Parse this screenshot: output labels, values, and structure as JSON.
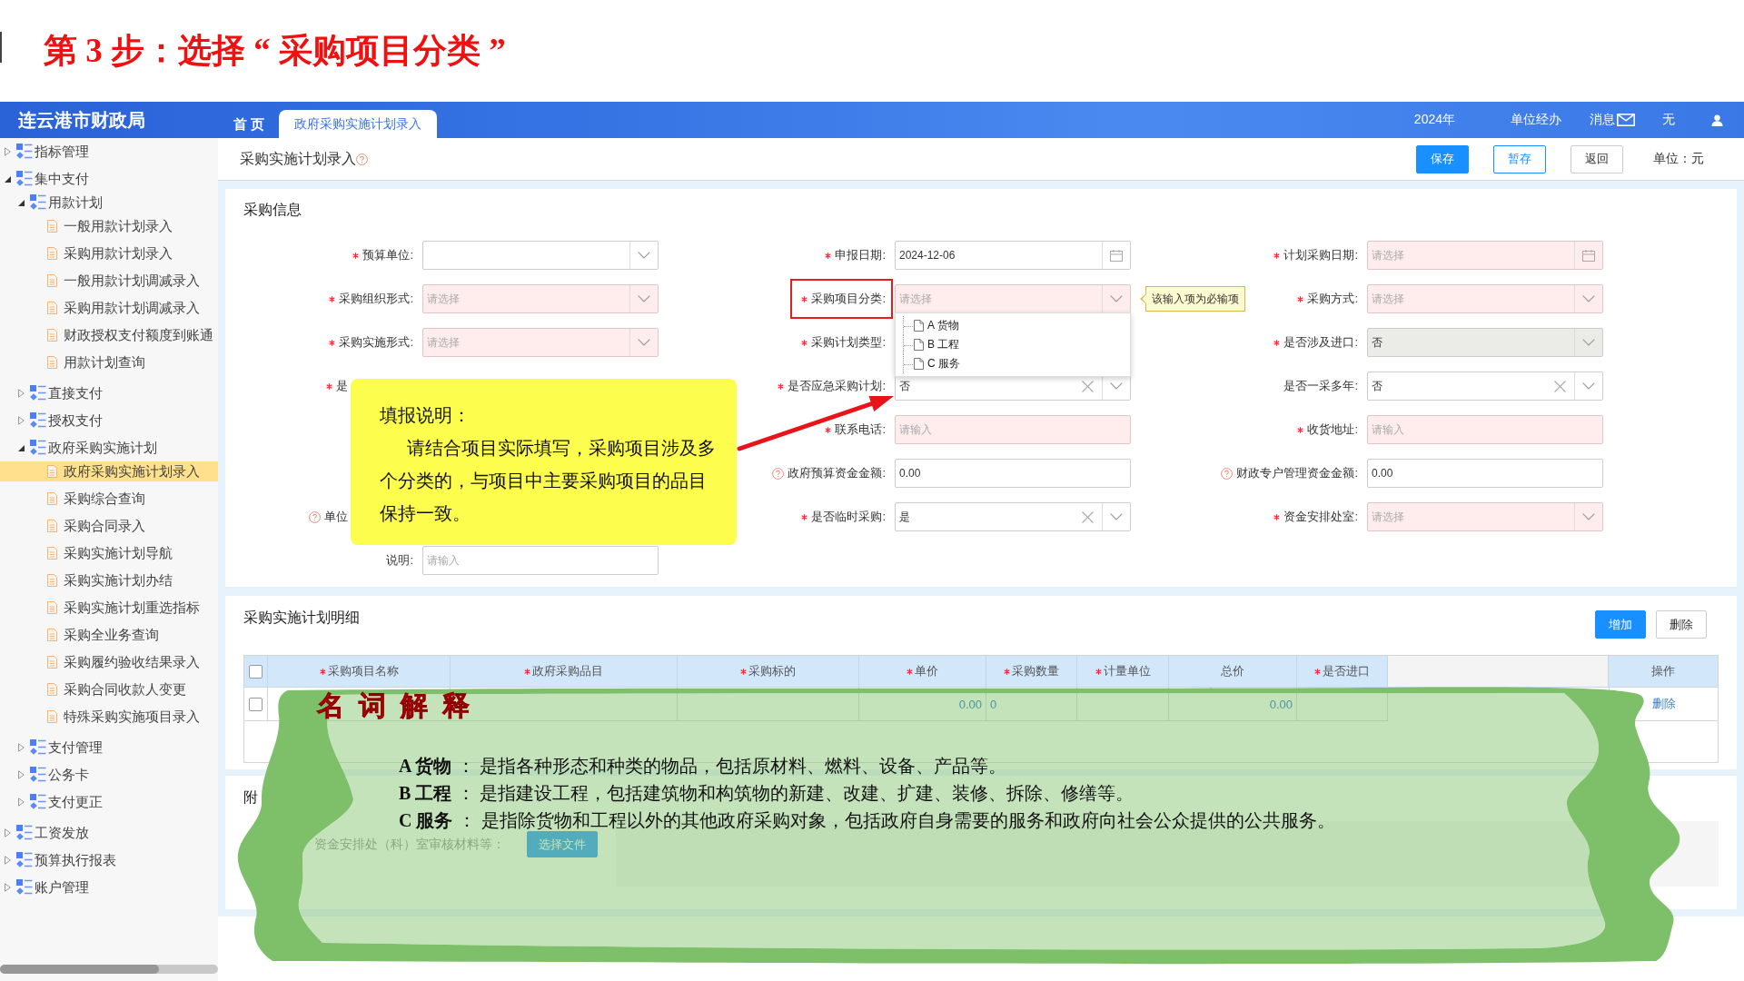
{
  "slide_title": "第 3 步：选择 “ 采购项目分类 ”",
  "header": {
    "logo": "连云港市财政局",
    "tabs": [
      {
        "label": "首 页",
        "selected": false
      },
      {
        "label": "政府采购实施计划录入",
        "selected": true
      }
    ],
    "year": "2024年",
    "role": "单位经办",
    "messages": "消息",
    "user": "无"
  },
  "sidebar": {
    "items": [
      {
        "label": "指标管理",
        "kind": "group",
        "expanded": false,
        "selected": false
      },
      {
        "label": "集中支付",
        "kind": "group",
        "expanded": true,
        "selected": false,
        "children": [
          {
            "label": "用款计划",
            "kind": "group",
            "expanded": true,
            "selected": false,
            "children": [
              {
                "label": "一般用款计划录入",
                "kind": "leaf",
                "selected": false
              },
              {
                "label": "采购用款计划录入",
                "kind": "leaf",
                "selected": false
              },
              {
                "label": "一般用款计划调减录入",
                "kind": "leaf",
                "selected": false
              },
              {
                "label": "采购用款计划调减录入",
                "kind": "leaf",
                "selected": false
              },
              {
                "label": "财政授权支付额度到账通",
                "kind": "leaf",
                "selected": false
              },
              {
                "label": "用款计划查询",
                "kind": "leaf",
                "selected": false
              }
            ]
          },
          {
            "label": "直接支付",
            "kind": "group",
            "expanded": false,
            "selected": false
          },
          {
            "label": "授权支付",
            "kind": "group",
            "expanded": false,
            "selected": false
          },
          {
            "label": "政府采购实施计划",
            "kind": "group",
            "expanded": true,
            "selected": false,
            "children": [
              {
                "label": "政府采购实施计划录入",
                "kind": "leaf",
                "selected": true
              },
              {
                "label": "采购综合查询",
                "kind": "leaf",
                "selected": false
              },
              {
                "label": "采购合同录入",
                "kind": "leaf",
                "selected": false
              },
              {
                "label": "采购实施计划导航",
                "kind": "leaf",
                "selected": false
              },
              {
                "label": "采购实施计划办结",
                "kind": "leaf",
                "selected": false
              },
              {
                "label": "采购实施计划重选指标",
                "kind": "leaf",
                "selected": false
              },
              {
                "label": "采购全业务查询",
                "kind": "leaf",
                "selected": false
              },
              {
                "label": "采购履约验收结果录入",
                "kind": "leaf",
                "selected": false
              },
              {
                "label": "采购合同收款人变更",
                "kind": "leaf",
                "selected": false
              },
              {
                "label": "特殊采购实施项目录入",
                "kind": "leaf",
                "selected": false
              }
            ]
          },
          {
            "label": "支付管理",
            "kind": "group",
            "expanded": false,
            "selected": false
          },
          {
            "label": "公务卡",
            "kind": "group",
            "expanded": false,
            "selected": false
          },
          {
            "label": "支付更正",
            "kind": "group",
            "expanded": false,
            "selected": false
          }
        ]
      },
      {
        "label": "工资发放",
        "kind": "group",
        "expanded": false,
        "selected": false
      },
      {
        "label": "预算执行报表",
        "kind": "group",
        "expanded": false,
        "selected": false
      },
      {
        "label": "账户管理",
        "kind": "group",
        "expanded": false,
        "selected": false
      }
    ]
  },
  "page": {
    "title": "采购实施计划录入",
    "help": true,
    "buttons": [
      {
        "label": "保存",
        "kind": "primary"
      },
      {
        "label": "暂存",
        "kind": "secondary"
      },
      {
        "label": "返回",
        "kind": "default"
      }
    ],
    "unit": "单位：元"
  },
  "form": {
    "title": "采购信息",
    "rows": [
      [
        {
          "kind": "field",
          "label": "预算单位:",
          "required": true,
          "help": false,
          "highlighted": false,
          "field": {
            "kind": "select",
            "invalid": false,
            "disabled": false
          }
        },
        {
          "kind": "field",
          "label": "申报日期:",
          "required": true,
          "help": false,
          "highlighted": false,
          "field": {
            "kind": "date",
            "value": "2024-12-06",
            "invalid": false,
            "disabled": false
          }
        },
        {
          "kind": "field",
          "label": "计划采购日期:",
          "required": true,
          "help": false,
          "highlighted": false,
          "field": {
            "kind": "date",
            "placeholder": "请选择",
            "invalid": true,
            "disabled": false
          }
        }
      ],
      [
        {
          "kind": "field",
          "label": "采购组织形式:",
          "required": true,
          "help": false,
          "highlighted": false,
          "field": {
            "kind": "select",
            "placeholder": "请选择",
            "invalid": true,
            "disabled": false
          }
        },
        {
          "kind": "field",
          "label": "采购项目分类:",
          "required": true,
          "help": false,
          "highlighted": true,
          "field": {
            "kind": "select",
            "placeholder": "请选择",
            "invalid": true,
            "disabled": false,
            "tip": "该输入项为必输项",
            "options": [
              {
                "label": "A 货物",
                "selected": false
              },
              {
                "label": "B 工程",
                "selected": false
              },
              {
                "label": "C 服务",
                "selected": false
              }
            ]
          }
        },
        {
          "kind": "field",
          "label": "采购方式:",
          "required": true,
          "help": false,
          "highlighted": false,
          "field": {
            "kind": "select",
            "placeholder": "请选择",
            "invalid": true,
            "disabled": false
          }
        }
      ],
      [
        {
          "kind": "field",
          "label": "采购实施形式:",
          "required": true,
          "help": false,
          "highlighted": false,
          "field": {
            "kind": "select",
            "placeholder": "请选择",
            "invalid": true,
            "disabled": false
          }
        },
        {
          "kind": "field",
          "label": "采购计划类型:",
          "required": true,
          "help": false,
          "highlighted": false
        },
        {
          "kind": "field",
          "label": "是否涉及进口:",
          "required": true,
          "help": false,
          "highlighted": false,
          "field": {
            "kind": "select",
            "value": "否",
            "invalid": false,
            "disabled": true
          }
        }
      ],
      [
        {
          "kind": "clipped",
          "label": "是",
          "required": true,
          "help": false,
          "highlighted": false
        },
        {
          "kind": "field",
          "label": "是否应急采购计划:",
          "required": true,
          "help": false,
          "highlighted": false,
          "field": {
            "kind": "select-clear",
            "value": "否",
            "invalid": false,
            "disabled": false
          }
        },
        {
          "kind": "field",
          "label": "是否一采多年:",
          "required": false,
          "help": false,
          "highlighted": false,
          "field": {
            "kind": "select-clear",
            "value": "否",
            "invalid": false,
            "disabled": false
          }
        }
      ],
      [
        {
          "kind": "empty"
        },
        {
          "kind": "field",
          "label": "联系电话:",
          "required": true,
          "help": false,
          "highlighted": false,
          "field": {
            "kind": "text",
            "placeholder": "请输入",
            "invalid": true,
            "disabled": false
          }
        },
        {
          "kind": "field",
          "label": "收货地址:",
          "required": true,
          "help": false,
          "highlighted": false,
          "field": {
            "kind": "text",
            "placeholder": "请输入",
            "invalid": true,
            "disabled": false
          }
        }
      ],
      [
        {
          "kind": "empty"
        },
        {
          "kind": "field",
          "label": "政府预算资金金额:",
          "required": false,
          "help": true,
          "highlighted": false,
          "field": {
            "kind": "text",
            "value": "0.00",
            "invalid": false,
            "disabled": false
          }
        },
        {
          "kind": "field",
          "label": "财政专户管理资金金额:",
          "required": false,
          "help": true,
          "highlighted": false,
          "field": {
            "kind": "text",
            "value": "0.00",
            "invalid": false,
            "disabled": false
          }
        }
      ],
      [
        {
          "kind": "clipped",
          "label": "单位",
          "required": false,
          "help": true,
          "highlighted": false
        },
        {
          "kind": "field",
          "label": "是否临时采购:",
          "required": true,
          "help": false,
          "highlighted": false,
          "field": {
            "kind": "select-clear",
            "value": "是",
            "invalid": false,
            "disabled": false
          }
        },
        {
          "kind": "field",
          "label": "资金安排处室:",
          "required": true,
          "help": false,
          "highlighted": false,
          "field": {
            "kind": "select",
            "placeholder": "请选择",
            "invalid": true,
            "disabled": false
          }
        }
      ],
      [
        {
          "kind": "field",
          "label": "说明:",
          "required": false,
          "help": false,
          "highlighted": false,
          "field": {
            "kind": "text",
            "placeholder": "请输入",
            "invalid": false,
            "disabled": false
          }
        },
        {
          "kind": "empty"
        },
        {
          "kind": "empty"
        }
      ]
    ]
  },
  "note": {
    "title": "填报说明：",
    "text": "请结合项目实际填写，采购项目涉及多个分类的，与项目中主要采购项目的品目保持一致。"
  },
  "detail": {
    "title": "采购实施计划明细",
    "buttons": [
      {
        "label": "增加",
        "kind": "primary"
      },
      {
        "label": "删除",
        "kind": "default"
      }
    ],
    "columns": [
      {
        "kind": "check",
        "checked": false
      },
      {
        "kind": "text",
        "label": "采购项目名称",
        "required": true
      },
      {
        "kind": "text",
        "label": "政府采购品目",
        "required": true
      },
      {
        "kind": "text",
        "label": "采购标的",
        "required": true
      },
      {
        "kind": "money",
        "label": "单价",
        "required": true
      },
      {
        "kind": "count",
        "label": "采购数量",
        "required": true
      },
      {
        "kind": "text",
        "label": "计量单位",
        "required": true
      },
      {
        "kind": "money",
        "label": "总价",
        "required": false
      },
      {
        "kind": "text",
        "label": "是否进口",
        "required": true
      },
      {
        "kind": "blank"
      },
      {
        "kind": "action",
        "label": "操作",
        "required": false
      }
    ],
    "rows": [
      {
        "checked": false,
        "cells": [
          null,
          null,
          null,
          "0.00",
          "0",
          null,
          "0.00",
          null
        ],
        "action": "删除"
      }
    ]
  },
  "attachment": {
    "title": "附",
    "hint": "资金安排处（科）室审核材料等：",
    "button": "选择文件"
  },
  "glossary": {
    "title": "名词解释",
    "entries": [
      "**A 货物** ： 是指各种形态和种类的物品，包括原材料、燃料、设备、产品等。",
      "**B 工程** ： 是指建设工程，包括建筑物和构筑物的新建、改建、扩建、装修、拆除、修缮等。",
      "**C 服务** ： 是指除货物和工程以外的其他政府采购对象，包括政府自身需要的服务和政府向社会公众提供的公共服务。"
    ]
  }
}
